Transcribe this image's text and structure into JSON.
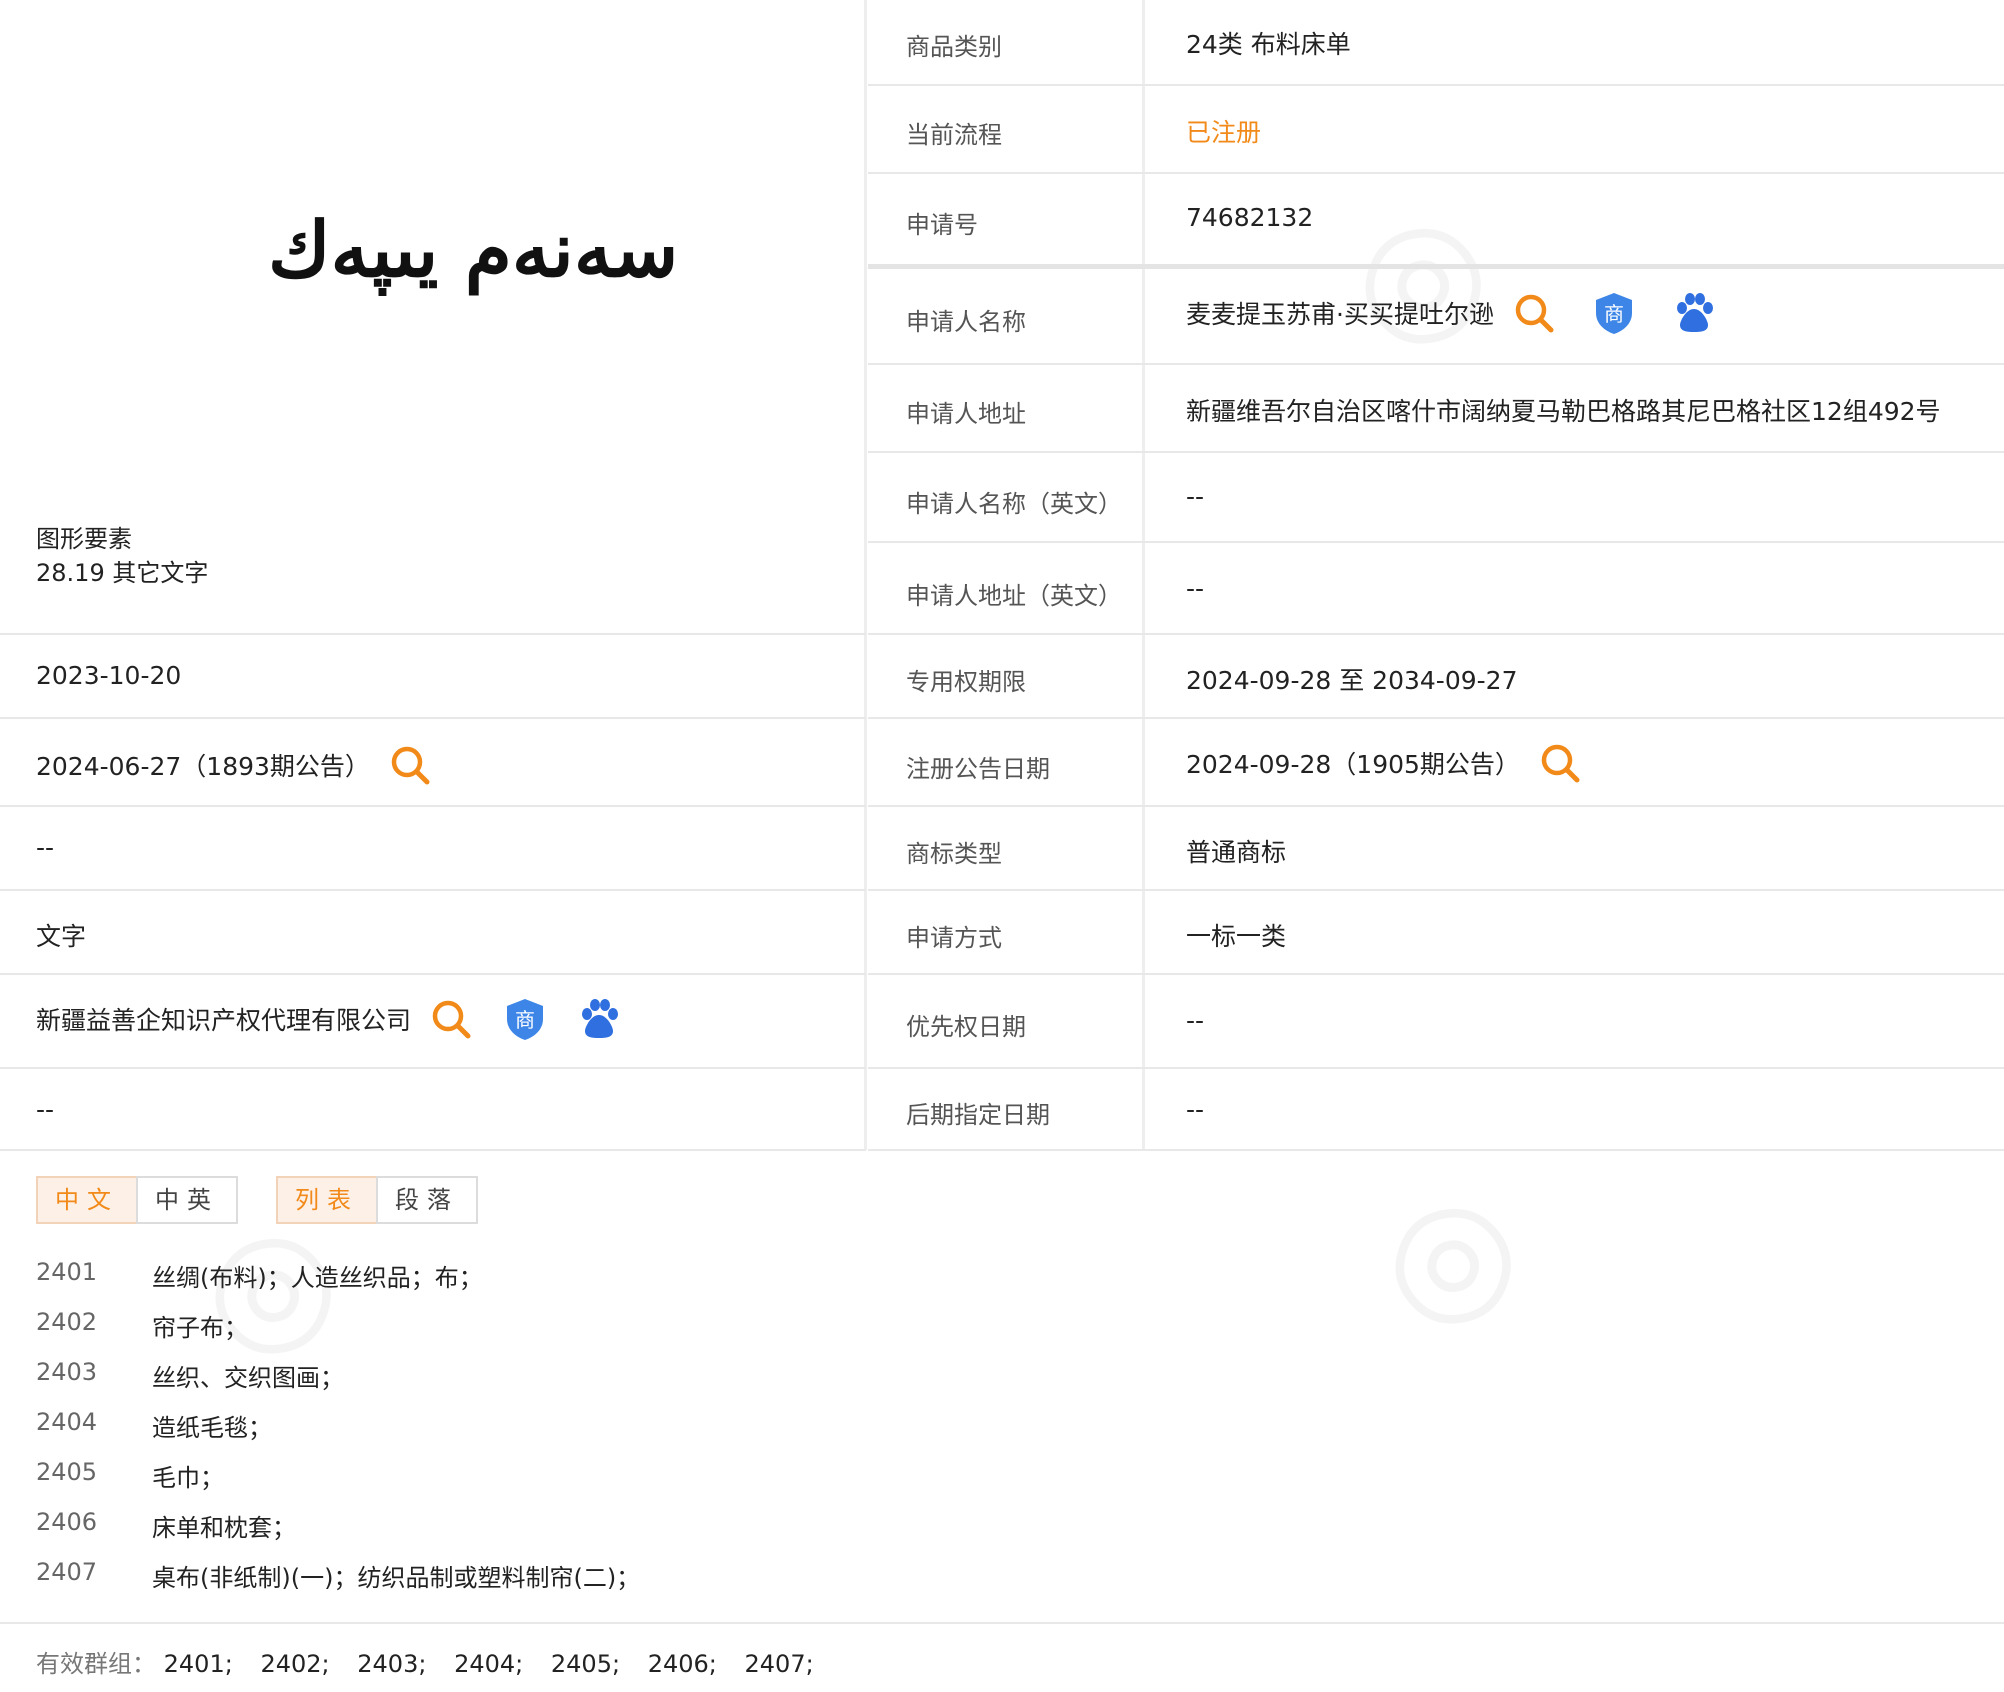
{
  "left": {
    "logo_text": "سەنەم يىپەك",
    "figure_label": "图形要素",
    "figure_value": "28.19 其它文字",
    "rows": [
      {
        "value": "2023-10-20"
      },
      {
        "value": "2024-06-27（1893期公告）"
      },
      {
        "value": "--"
      },
      {
        "value": "文字"
      },
      {
        "value": "新疆益善企知识产权代理有限公司"
      },
      {
        "value": "--"
      }
    ]
  },
  "right": {
    "rows": [
      {
        "label": "商品类别",
        "value": "24类 布料床单"
      },
      {
        "label": "当前流程",
        "value": "已注册"
      },
      {
        "label": "申请号",
        "value": "74682132"
      },
      {
        "label": "申请人名称",
        "value": "麦麦提玉苏甫·买买提吐尔逊"
      },
      {
        "label": "申请人地址",
        "value": "新疆维吾尔自治区喀什市阔纳夏马勒巴格路其尼巴格社区12组492号"
      },
      {
        "label": "申请人名称（英文）",
        "value": "--"
      },
      {
        "label": "申请人地址（英文）",
        "value": "--"
      },
      {
        "label": "专用权期限",
        "value": "2024-09-28 至 2034-09-27"
      },
      {
        "label": "注册公告日期",
        "value": "2024-09-28（1905期公告）"
      },
      {
        "label": "商标类型",
        "value": "普通商标"
      },
      {
        "label": "申请方式",
        "value": "一标一类"
      },
      {
        "label": "优先权日期",
        "value": "--"
      },
      {
        "label": "后期指定日期",
        "value": "--"
      }
    ]
  },
  "tabs": {
    "lang": [
      "中文",
      "中英"
    ],
    "view": [
      "列表",
      "段落"
    ]
  },
  "goods": [
    {
      "code": "2401",
      "name": "丝绸(布料)；人造丝织品；布；"
    },
    {
      "code": "2402",
      "name": "帘子布；"
    },
    {
      "code": "2403",
      "name": "丝织、交织图画；"
    },
    {
      "code": "2404",
      "name": "造纸毛毯；"
    },
    {
      "code": "2405",
      "name": "毛巾；"
    },
    {
      "code": "2406",
      "name": "床单和枕套；"
    },
    {
      "code": "2407",
      "name": "桌布(非纸制)(一)；纺织品制或塑料制帘(二)；"
    }
  ],
  "groups": {
    "label": "有效群组：",
    "items": [
      "2401;",
      "2402;",
      "2403;",
      "2404;",
      "2405;",
      "2406;",
      "2407;"
    ]
  },
  "icons": {
    "search": "search-icon",
    "trademark": "trademark-shield-icon",
    "baidu": "baidu-paw-icon"
  },
  "colors": {
    "accent": "#f28a1a",
    "shield": "#3d86e8",
    "paw": "#2f6fe0"
  }
}
